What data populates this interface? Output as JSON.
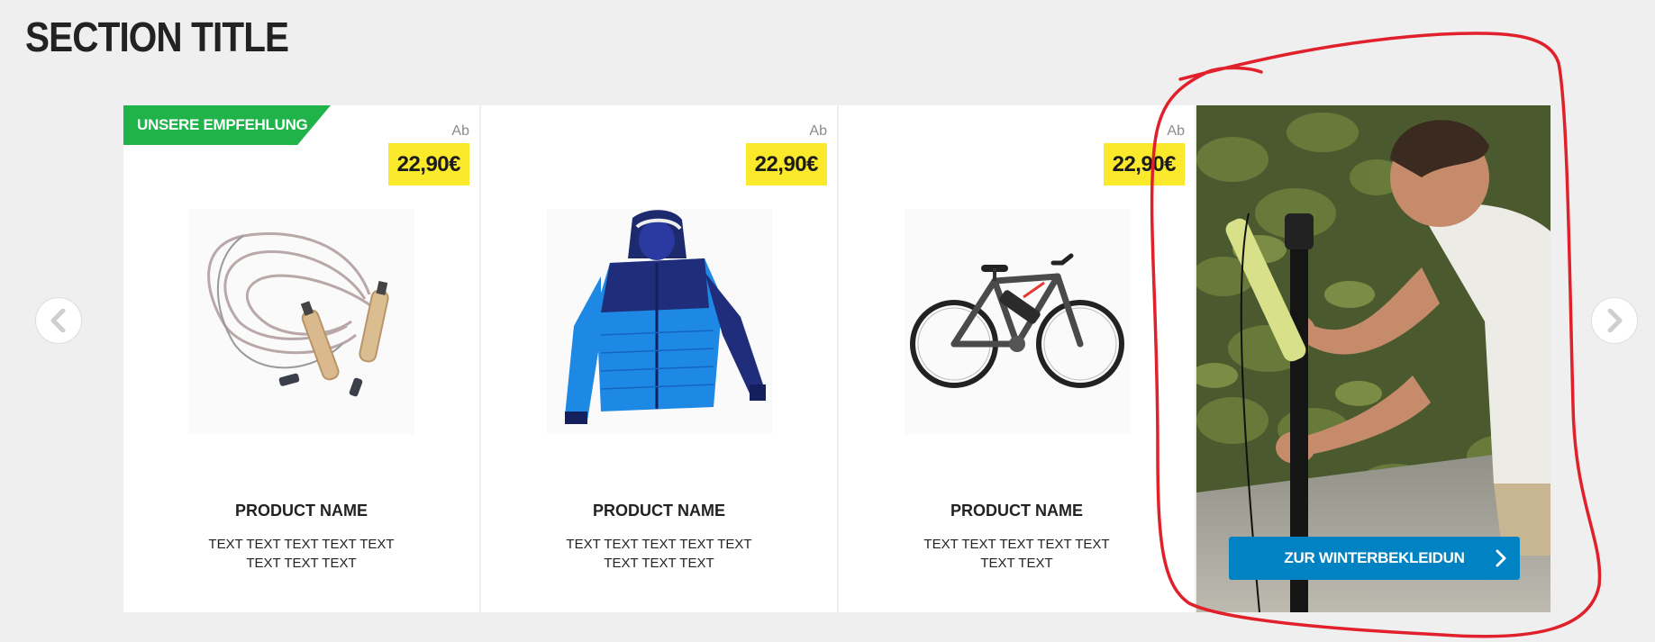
{
  "section": {
    "title": "SECTION TITLE"
  },
  "carousel": {
    "prev_icon": "chevron-left-icon",
    "next_icon": "chevron-right-icon"
  },
  "cards": [
    {
      "badge": "UNSERE EMPFEHLUNG",
      "price_prefix": "Ab",
      "price": "22,90€",
      "image": "jump-rope",
      "name": "PRODUCT NAME",
      "description": "TEXT TEXT TEXT TEXT TEXT TEXT TEXT TEXT"
    },
    {
      "badge": "",
      "price_prefix": "Ab",
      "price": "22,90€",
      "image": "ski-jacket",
      "name": "PRODUCT NAME",
      "description": "TEXT TEXT TEXT TEXT TEXT TEXT TEXT TEXT"
    },
    {
      "badge": "",
      "price_prefix": "Ab",
      "price": "22,90€",
      "image": "e-bike",
      "name": "PRODUCT NAME",
      "description": "TEXT TEXT TEXT TEXT TEXT TEXT TEXT"
    }
  ],
  "promo": {
    "image": "man-inflating-ball-with-pump",
    "button_label": "ZUR WINTERBEKLEIDUN",
    "button_icon": "chevron-right-icon"
  },
  "colors": {
    "badge_green": "#1fb34a",
    "price_yellow": "#fbe92c",
    "button_blue": "#0082c3",
    "annotation_red": "#e0202a",
    "background": "#efefef"
  }
}
